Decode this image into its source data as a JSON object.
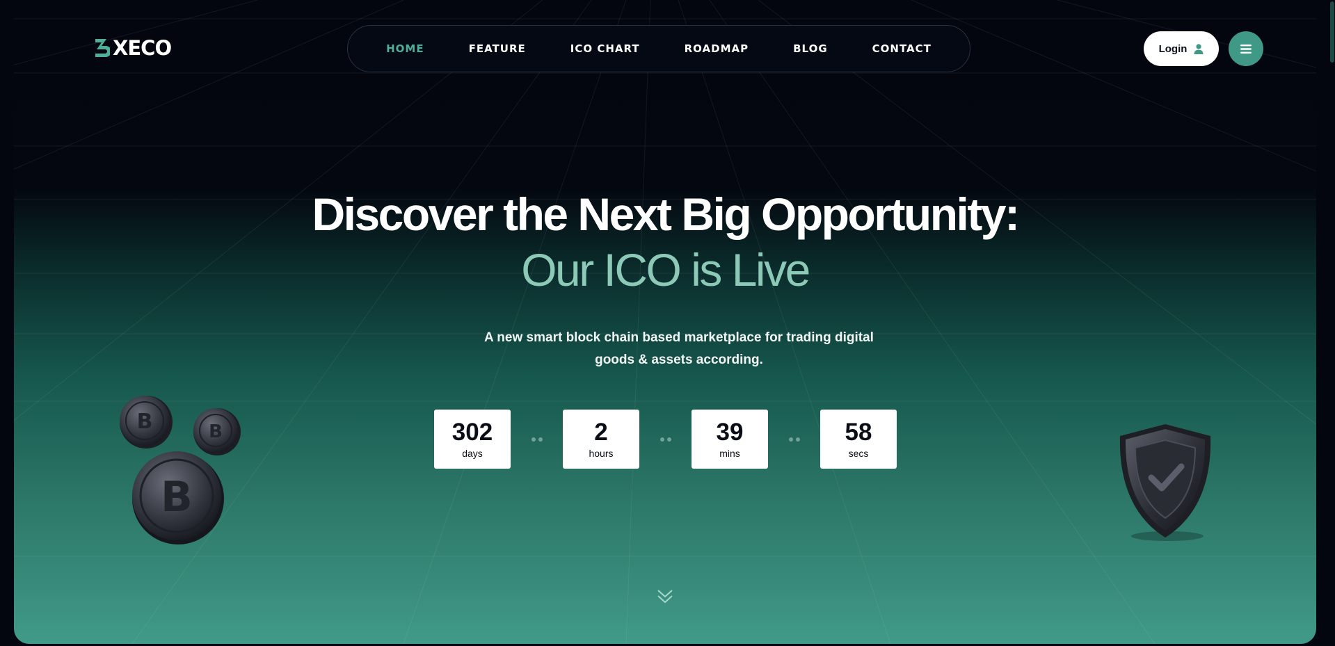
{
  "brand": {
    "name": "XECO",
    "accent_color": "#4fae9a"
  },
  "nav": {
    "items": [
      {
        "label": "HOME",
        "active": true
      },
      {
        "label": "FEATURE",
        "active": false
      },
      {
        "label": "ICO CHART",
        "active": false
      },
      {
        "label": "ROADMAP",
        "active": false
      },
      {
        "label": "BLOG",
        "active": false
      },
      {
        "label": "CONTACT",
        "active": false
      }
    ]
  },
  "header": {
    "login_label": "Login",
    "login_icon": "user-icon",
    "menu_icon": "hamburger-icon"
  },
  "hero": {
    "title": "Discover the Next Big Opportunity:",
    "title_accent": "Our ICO is Live",
    "subtitle": "A new smart block chain based marketplace for trading digital goods & assets according.",
    "countdown": [
      {
        "value": "302",
        "unit": "days"
      },
      {
        "value": "2",
        "unit": "hours"
      },
      {
        "value": "39",
        "unit": "mins"
      },
      {
        "value": "58",
        "unit": "secs"
      }
    ],
    "scroll_icon": "chevron-double-down-icon",
    "decor_left": "bitcoin-coins-illustration",
    "decor_right": "shield-check-illustration"
  }
}
